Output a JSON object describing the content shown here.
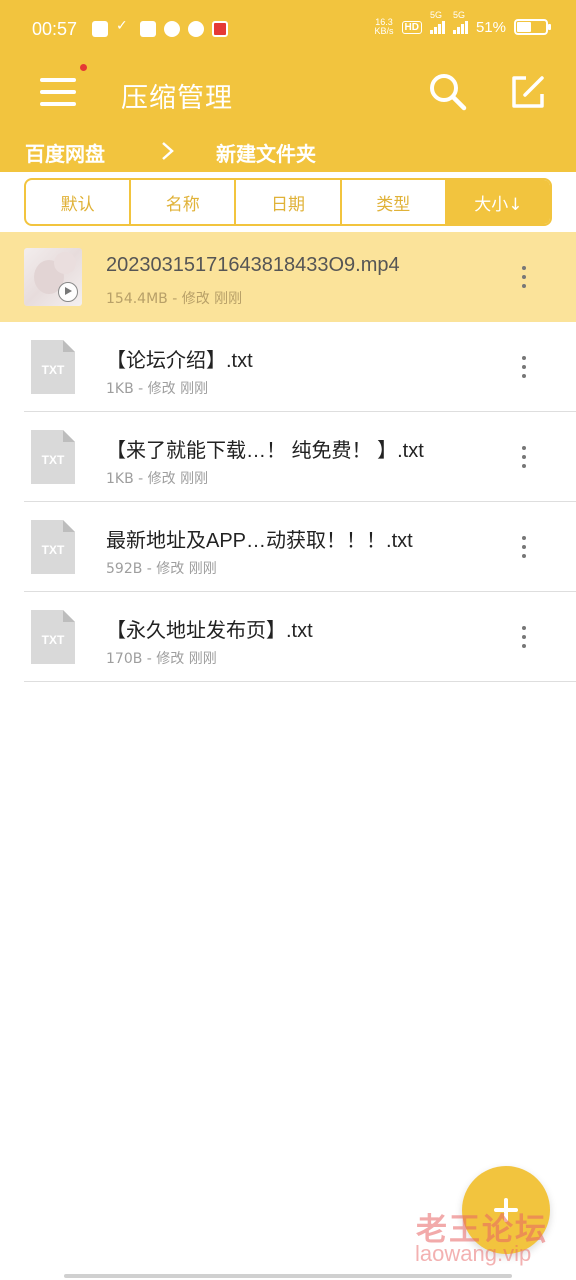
{
  "status_bar": {
    "time": "00:57",
    "net_speed_value": "16.3",
    "net_speed_unit": "KB/s",
    "hd_badge": "HD",
    "signal_1_label": "5G",
    "signal_2_label": "5G",
    "battery": "51%",
    "battery_level": 0.51
  },
  "toolbar": {
    "title": "压缩管理",
    "menu_icon": "hamburger-menu-icon",
    "search_icon": "search-icon",
    "edit_icon": "edit-icon"
  },
  "breadcrumb": {
    "items": [
      "百度网盘",
      "新建文件夹"
    ]
  },
  "sort_tabs": {
    "items": [
      "默认",
      "名称",
      "日期",
      "类型",
      "大小↓"
    ],
    "active_index": 4
  },
  "files": [
    {
      "name": "20230315171643818433O9.mp4",
      "meta": "154.4MB - 修改 刚刚",
      "type": "video",
      "selected": true
    },
    {
      "name": "【论坛介绍】.txt",
      "meta": "1KB - 修改 刚刚",
      "type": "txt",
      "selected": false
    },
    {
      "name": "【来了就能下载…！ 纯免费！ 】.txt",
      "meta": "1KB - 修改 刚刚",
      "type": "txt",
      "selected": false
    },
    {
      "name": "最新地址及APP…动获取！！！.txt",
      "meta": "592B - 修改 刚刚",
      "type": "txt",
      "selected": false
    },
    {
      "name": "【永久地址发布页】.txt",
      "meta": "170B - 修改 刚刚",
      "type": "txt",
      "selected": false
    }
  ],
  "file_type_label": "TXT",
  "fab_icon": "plus-icon",
  "watermark": {
    "title": "老王论坛",
    "url": "laowang.vip"
  },
  "colors": {
    "accent": "#F2C43E",
    "selected_row": "#FBE39A",
    "badge_red": "#E53935"
  }
}
